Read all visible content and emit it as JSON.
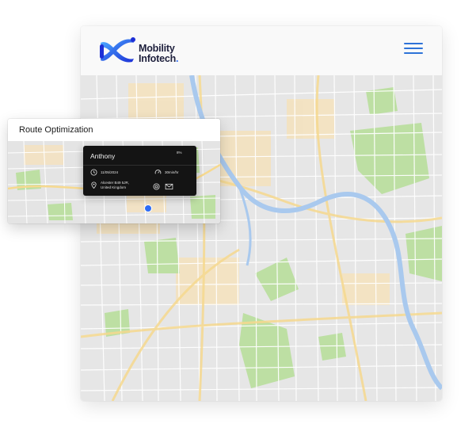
{
  "brand": {
    "line1": "Mobility",
    "line2": "Infotech",
    "dot": ".",
    "accent": "#2d6cf6"
  },
  "topbar": {
    "menu_icon": "hamburger-menu-icon"
  },
  "panel": {
    "title": "Route Optimization",
    "card": {
      "name": "Anthony",
      "battery": "8%",
      "date": "11/05/2024",
      "speed": "30min/hr",
      "address_line1": "Alcester B49 5JR,",
      "address_line2": "United Kingdom",
      "icons": [
        "clock-icon",
        "speedometer-icon",
        "location-pin-icon",
        "camera-icon",
        "mail-icon"
      ]
    }
  },
  "colors": {
    "map_bg": "#e6e6e6",
    "river": "#a9c9ee",
    "park": "#bddfa3",
    "major_road": "#f8e3ba",
    "card_bg": "#141414"
  }
}
